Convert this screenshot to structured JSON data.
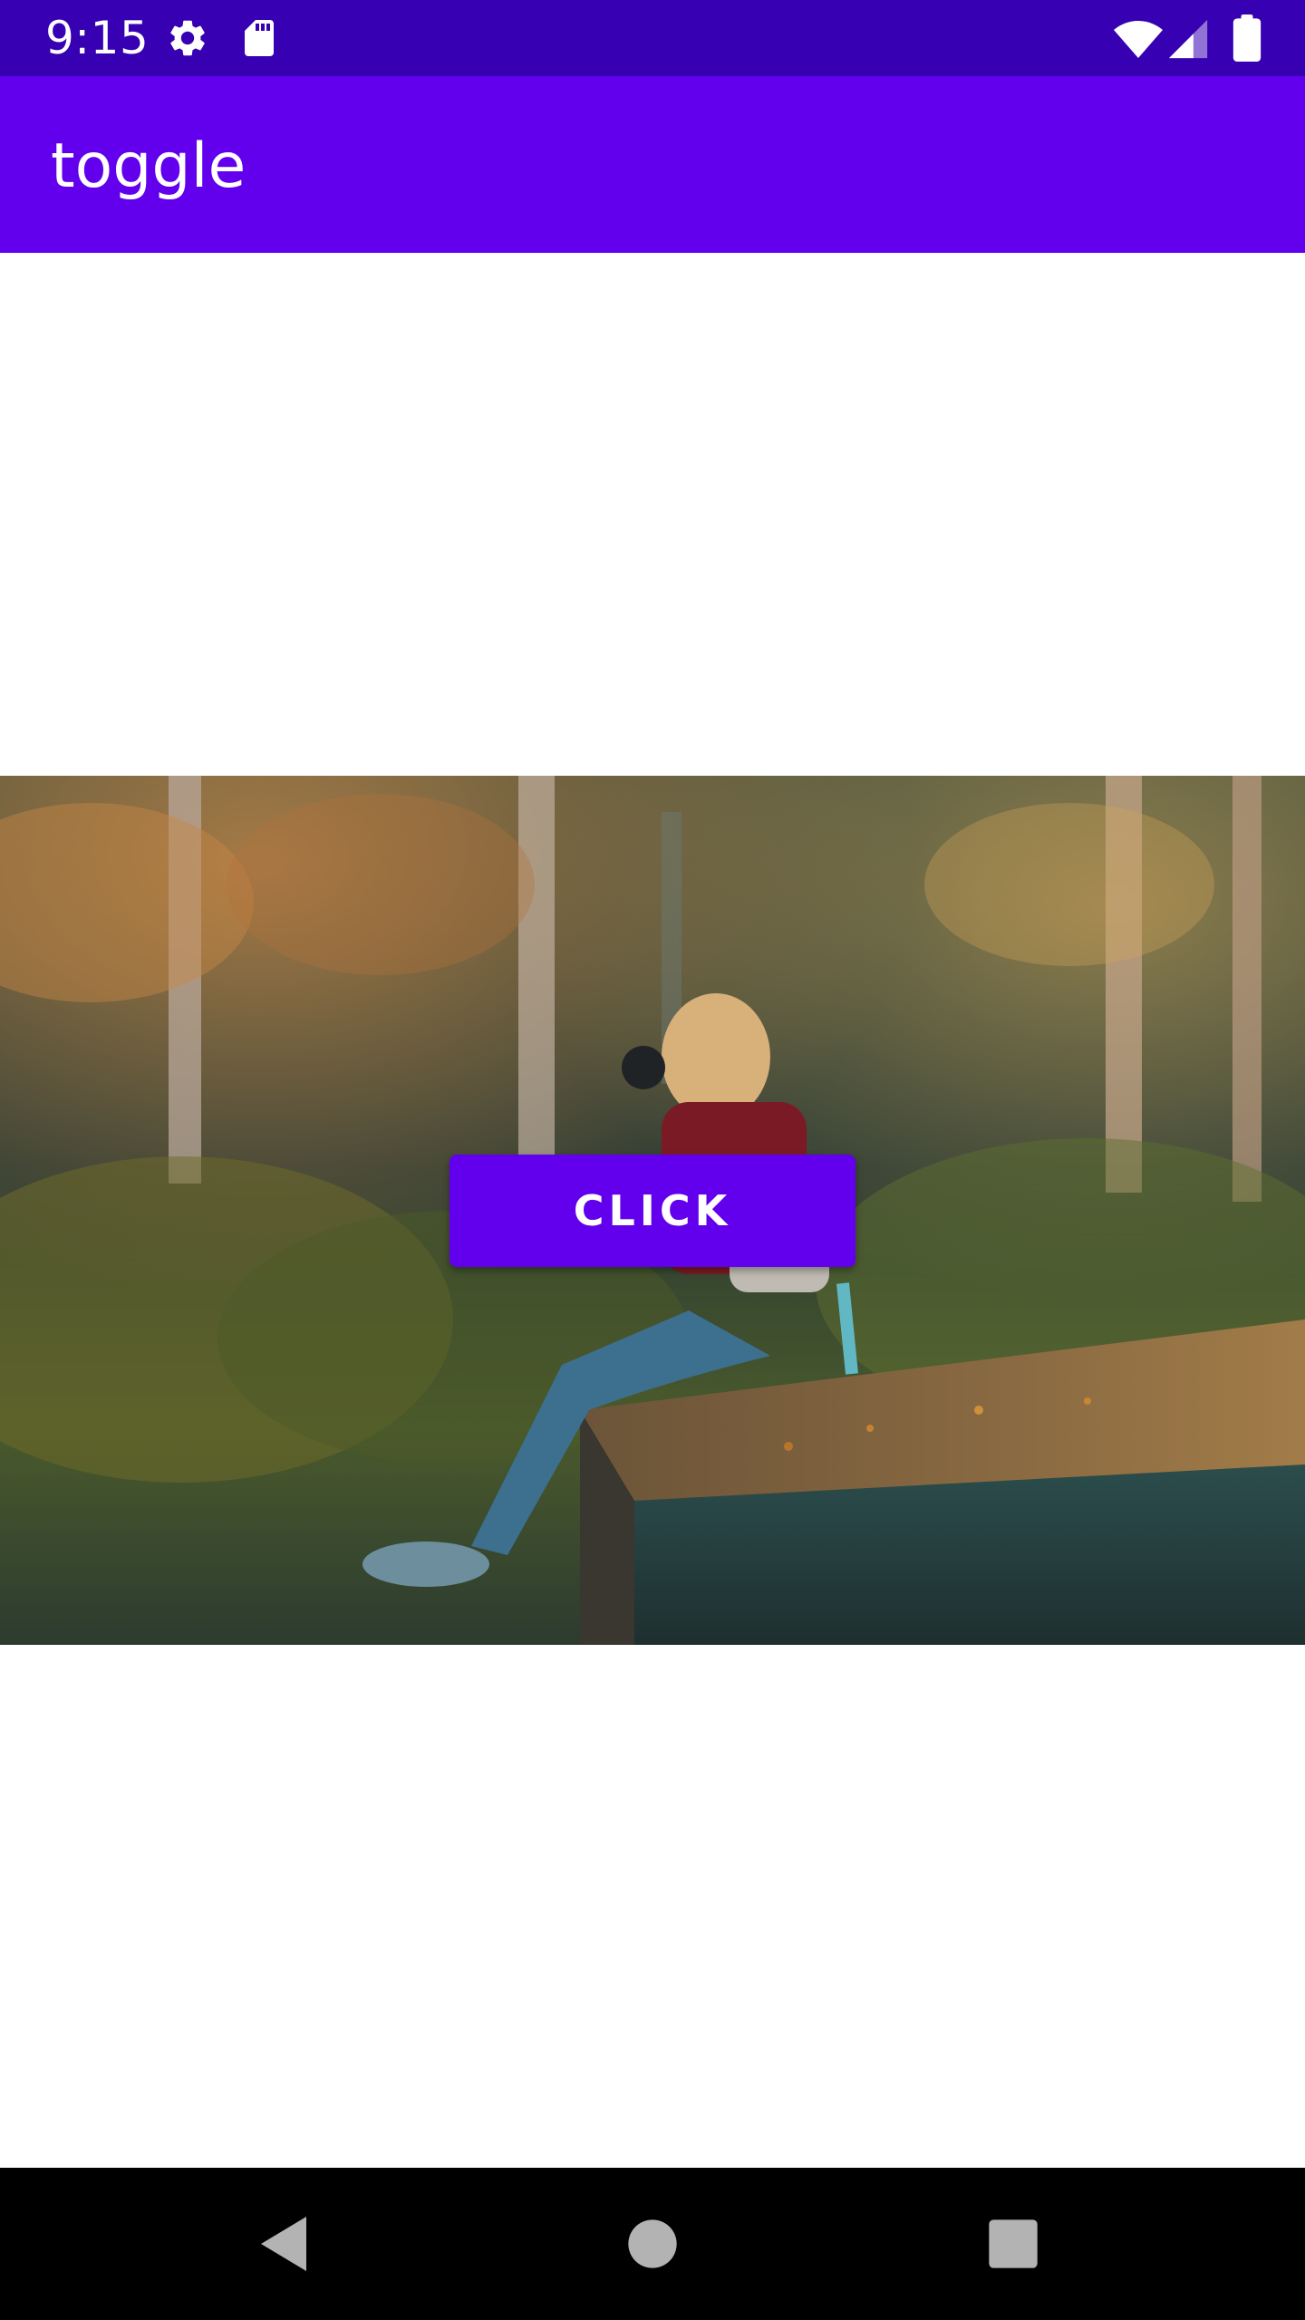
{
  "status_bar": {
    "time": "9:15",
    "icons": [
      "settings-icon",
      "sd-card-icon",
      "wifi-icon",
      "cell-signal-icon",
      "battery-icon"
    ]
  },
  "app_bar": {
    "title": "toggle"
  },
  "main": {
    "image": {
      "semantic": "forest photographer photo"
    },
    "button": {
      "label": "CLICK"
    }
  },
  "nav_bar": {
    "icons": [
      "back-icon",
      "home-icon",
      "recents-icon"
    ]
  },
  "colors": {
    "status_bar": "#3700b3",
    "app_bar": "#6200ee",
    "accent": "#6200ee",
    "nav_bar": "#000000",
    "background": "#ffffff"
  }
}
